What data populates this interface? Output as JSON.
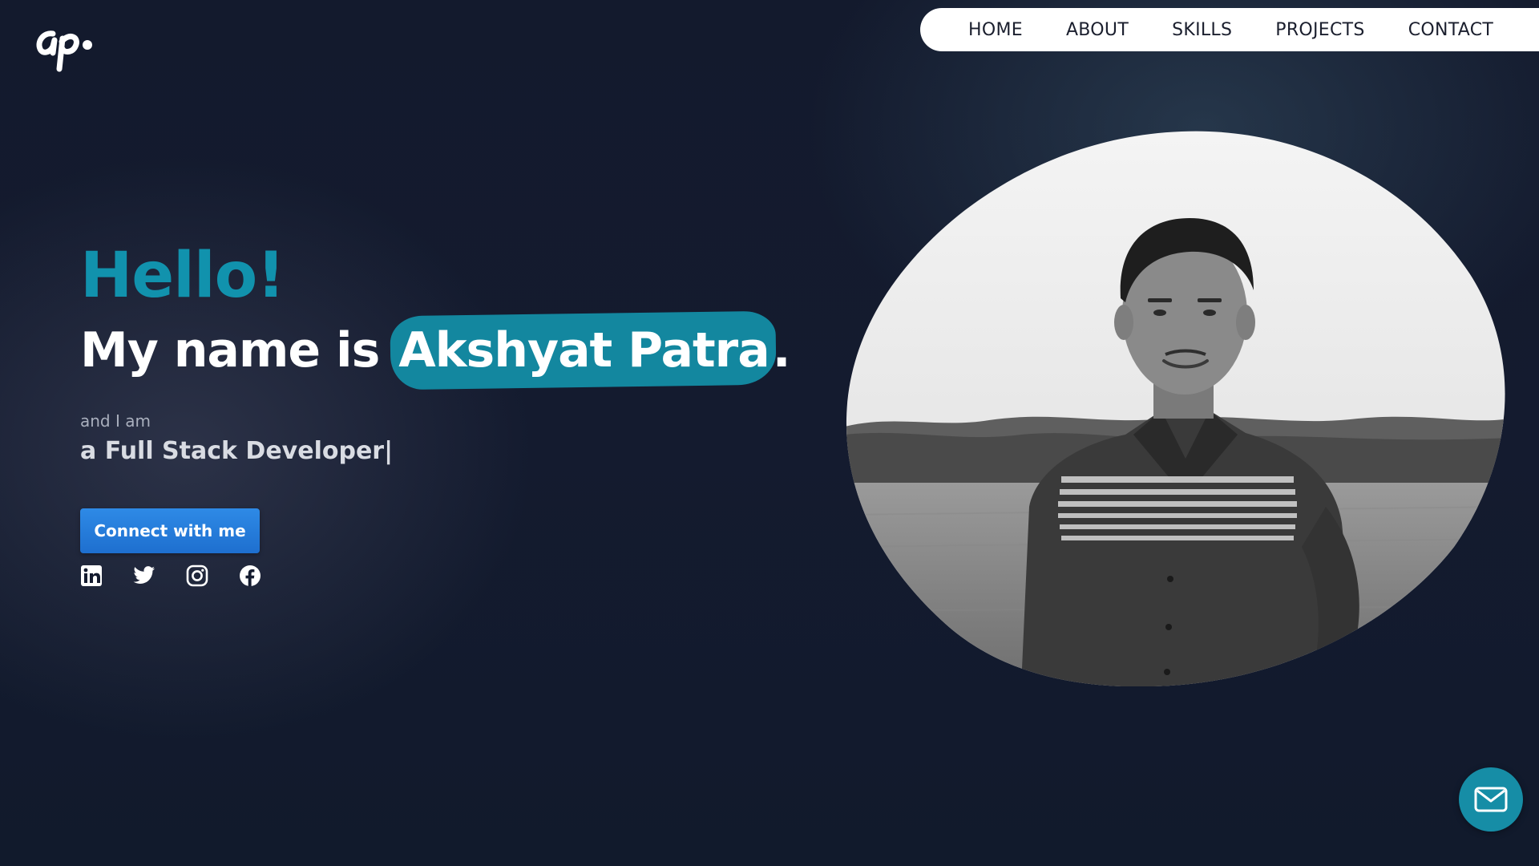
{
  "logo": {
    "text": "ap."
  },
  "nav": {
    "items": [
      {
        "label": "HOME"
      },
      {
        "label": "ABOUT"
      },
      {
        "label": "SKILLS"
      },
      {
        "label": "PROJECTS"
      },
      {
        "label": "CONTACT"
      }
    ]
  },
  "hero": {
    "greeting": "Hello!",
    "name_prefix": "My name is ",
    "name": "Akshyat Patra",
    "name_suffix": ".",
    "intro": "and I am",
    "role": "a Full Stack Developer|",
    "cta_label": "Connect with me"
  },
  "socials": [
    {
      "icon": "linkedin-icon"
    },
    {
      "icon": "twitter-icon"
    },
    {
      "icon": "instagram-icon"
    },
    {
      "icon": "facebook-icon"
    }
  ],
  "colors": {
    "background": "#111a2c",
    "accent": "#1192ad",
    "highlight": "#13879f",
    "cta": "#2e8ae6",
    "nav_bg": "#ffffff",
    "nav_text": "#1b1f2e"
  },
  "floating": {
    "icon": "mail-icon"
  }
}
